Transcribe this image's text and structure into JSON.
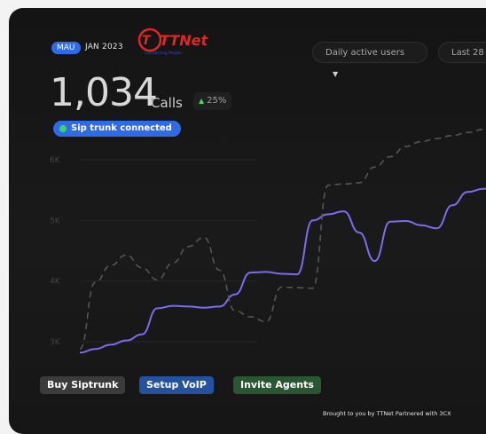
{
  "header": {
    "badge": "MAU",
    "period": "JAN 2023",
    "logo": {
      "brand": "TTNet",
      "tagline": "Connecting People"
    },
    "metric_dropdown": {
      "label": "Daily active users",
      "icon": "chevron-down-icon"
    },
    "range_dropdown": {
      "label": "Last 28"
    }
  },
  "stats": {
    "value": "1,034",
    "unit": "Calls",
    "delta": "25%",
    "delta_icon": "triangle-up-icon",
    "delta_color": "#4ad06b"
  },
  "status": {
    "label": "Sip trunk connected",
    "dot_color": "#3dd36b"
  },
  "chart_data": {
    "type": "line",
    "yticks": [
      "6K",
      "5K",
      "4K",
      "3K"
    ],
    "ylim": [
      2800,
      6200
    ],
    "x": [
      0,
      1,
      2,
      3,
      4,
      5,
      6,
      7,
      8,
      9,
      10,
      11,
      12,
      13,
      14,
      15,
      16,
      17,
      18,
      19,
      20,
      21,
      22,
      23,
      24,
      25,
      26,
      27,
      28
    ],
    "grid": true,
    "series": [
      {
        "color": "#7c6cf0",
        "style": "solid",
        "values": [
          2820,
          2880,
          2950,
          3020,
          3120,
          3550,
          3590,
          3580,
          3560,
          3580,
          3780,
          4140,
          4150,
          4120,
          4110,
          5000,
          5100,
          5150,
          4800,
          4330,
          4980,
          4990,
          4920,
          4870,
          5250,
          5470,
          5520,
          5580,
          5650
        ]
      },
      {
        "color": "#555555",
        "style": "dashed",
        "values": [
          2880,
          3980,
          4260,
          4430,
          4220,
          4020,
          4300,
          4570,
          4720,
          4180,
          3510,
          3410,
          3330,
          3900,
          3890,
          3880,
          5580,
          5600,
          5620,
          5880,
          6050,
          6220,
          6300,
          6350,
          6400,
          6450,
          6500,
          6550,
          6600
        ]
      }
    ]
  },
  "actions": {
    "buy": "Buy Siptrunk",
    "voip": "Setup VoIP",
    "agents": "Invite Agents"
  },
  "footer": "Brought to you by TTNet Partnered with 3CX"
}
